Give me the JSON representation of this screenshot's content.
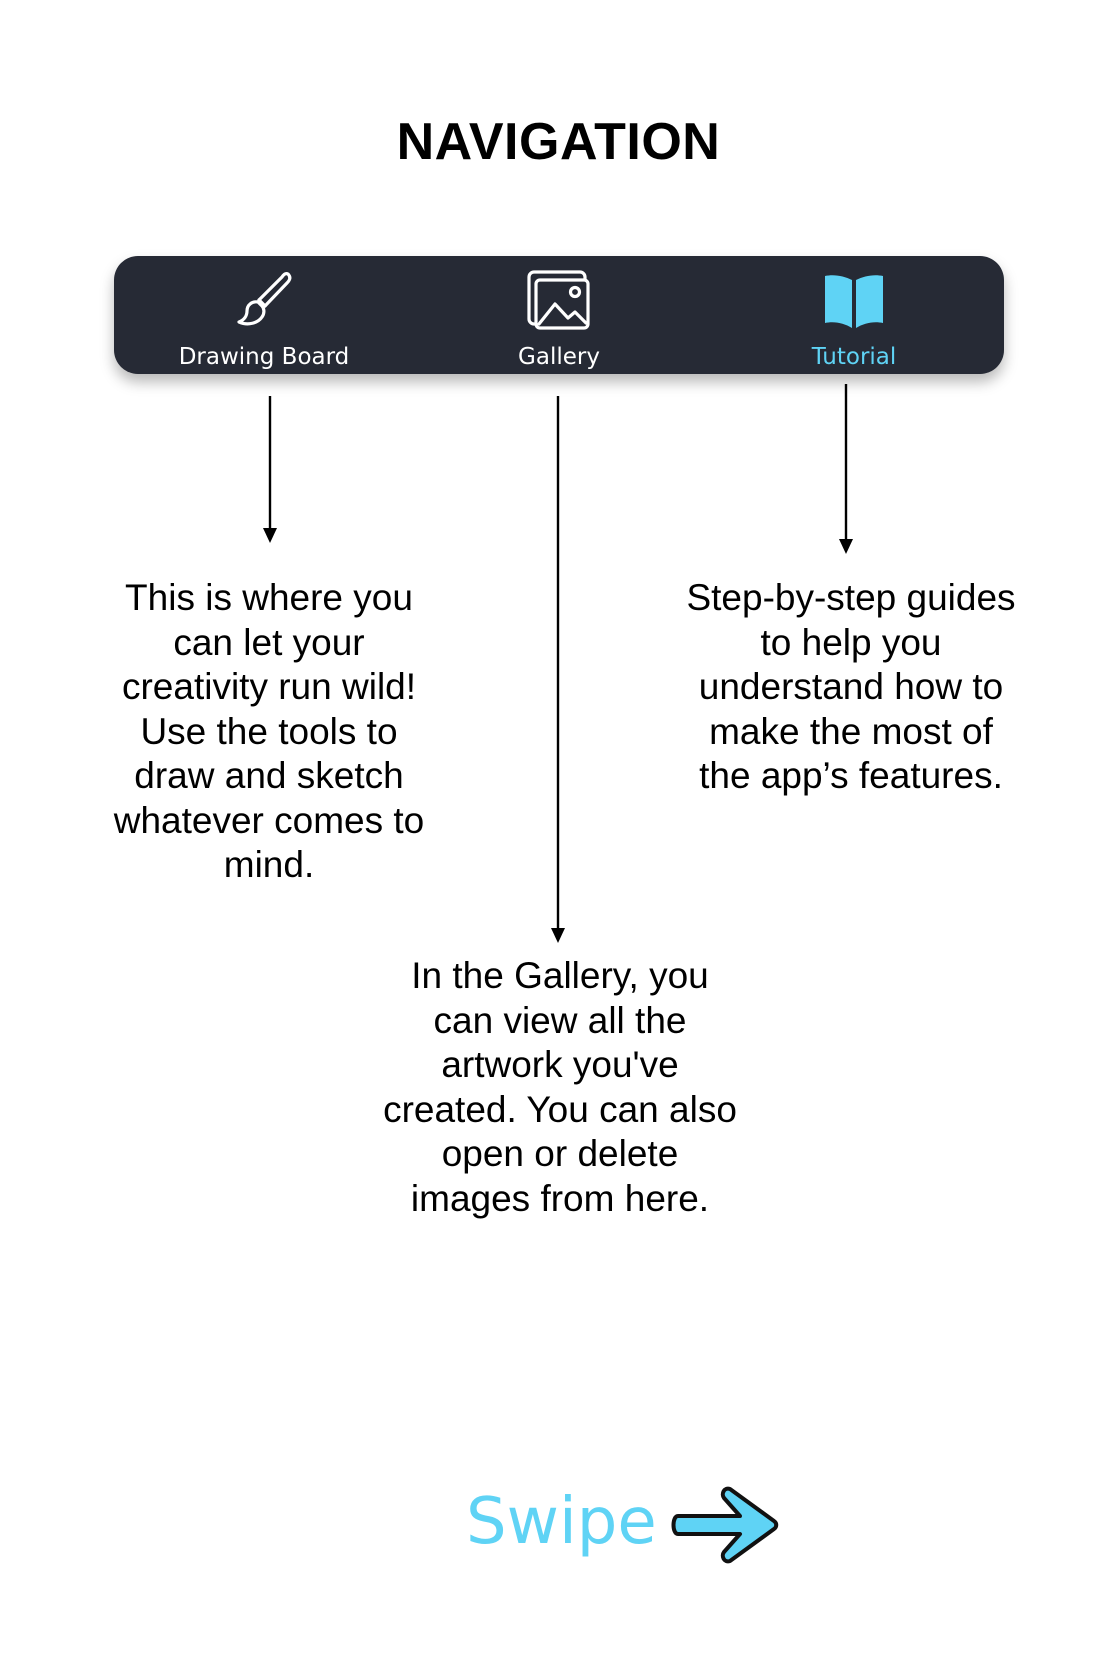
{
  "page": {
    "title": "NAVIGATION"
  },
  "nav": {
    "items": [
      {
        "label": "Drawing Board",
        "icon": "paintbrush-icon",
        "active": false
      },
      {
        "label": "Gallery",
        "icon": "image-gallery-icon",
        "active": false
      },
      {
        "label": "Tutorial",
        "icon": "open-book-icon",
        "active": true
      }
    ],
    "colors": {
      "bar_background": "#262a35",
      "label_default": "#ffffff",
      "label_active": "#5fd3f5"
    }
  },
  "descriptions": {
    "drawing_board": "This is where you can let your creativity run wild! Use the tools to draw and sketch whatever comes to mind.",
    "gallery": "In the Gallery, you can view all the artwork you've created. You can also open or delete images from here.",
    "tutorial": "Step-by-step guides to help you understand how to make the most of the app’s features."
  },
  "swipe": {
    "label": "Swipe",
    "icon": "right-arrow-icon",
    "color": "#5fd3f5"
  }
}
